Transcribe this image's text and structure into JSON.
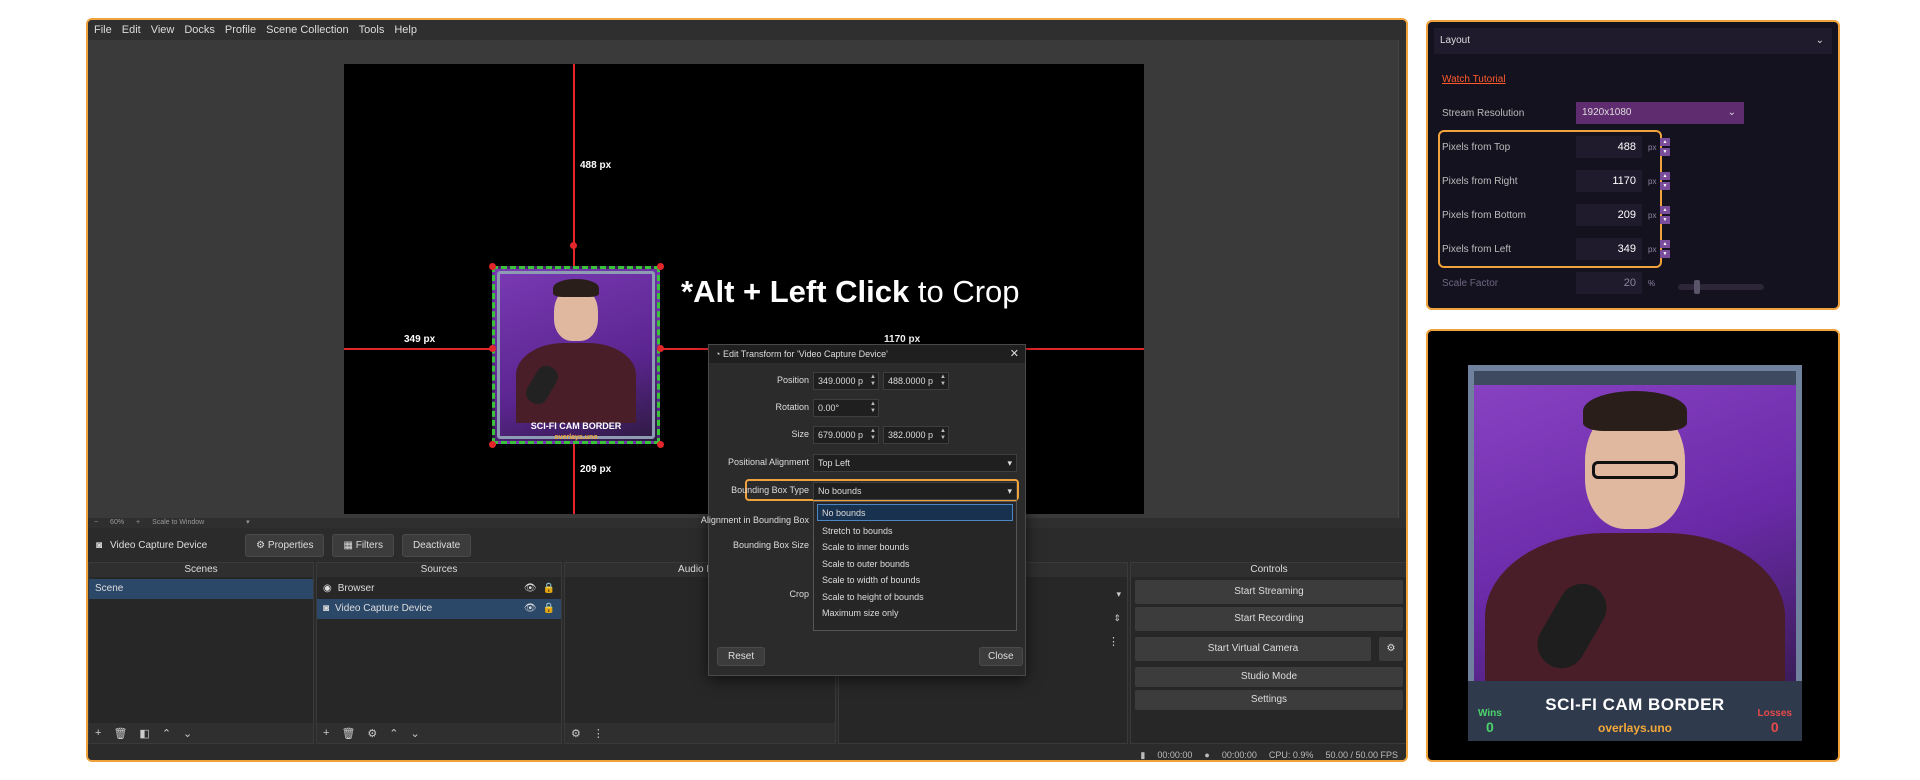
{
  "menu": [
    "File",
    "Edit",
    "View",
    "Docks",
    "Profile",
    "Scene Collection",
    "Tools",
    "Help"
  ],
  "preview": {
    "top_px": "488 px",
    "left_px": "349 px",
    "right_px": "1170 px",
    "bottom_px": "209 px",
    "crop_bold": "*Alt + Left Click",
    "crop_rest": " to Crop",
    "cam_title": "SCI-FI CAM BORDER",
    "cam_url": "overlays.uno"
  },
  "zoom": {
    "value": "60%",
    "mode": "Scale to Window"
  },
  "source_bar": {
    "name": "Video Capture Device",
    "properties": "Properties",
    "filters": "Filters",
    "deactivate": "Deactivate"
  },
  "docks": {
    "scenes": {
      "title": "Scenes",
      "items": [
        "Scene"
      ]
    },
    "sources": {
      "title": "Sources",
      "items": [
        "Browser",
        "Video Capture Device"
      ]
    },
    "audio": {
      "title": "Audio Mix"
    },
    "controls": {
      "title": "Controls",
      "buttons": [
        "Start Streaming",
        "Start Recording",
        "Start Virtual Camera",
        "Studio Mode",
        "Settings"
      ]
    }
  },
  "status": {
    "time1": "00:00:00",
    "time2": "00:00:00",
    "cpu": "CPU: 0.9%",
    "fps": "50.00 / 50.00 FPS"
  },
  "dialog": {
    "title": "Edit Transform for 'Video Capture Device'",
    "position_label": "Position",
    "position_x": "349.0000 p",
    "position_y": "488.0000 p",
    "rotation_label": "Rotation",
    "rotation": "0.00°",
    "size_label": "Size",
    "size_w": "679.0000 p",
    "size_h": "382.0000 p",
    "pos_align_label": "Positional Alignment",
    "pos_align": "Top Left",
    "bbox_type_label": "Bounding Box Type",
    "bbox_type": "No bounds",
    "align_bbox_label": "Alignment in Bounding Box",
    "bbox_size_label": "Bounding Box Size",
    "crop_label": "Crop",
    "reset": "Reset",
    "close": "Close",
    "options": [
      "No bounds",
      "Stretch to bounds",
      "Scale to inner bounds",
      "Scale to outer bounds",
      "Scale to width of bounds",
      "Scale to height of bounds",
      "Maximum size only"
    ]
  },
  "layout_panel": {
    "header": "Layout",
    "tutorial": "Watch Tutorial",
    "resolution_label": "Stream Resolution",
    "resolution": "1920x1080",
    "fields": [
      {
        "label": "Pixels from Top",
        "value": "488",
        "unit": "px"
      },
      {
        "label": "Pixels from Right",
        "value": "1170",
        "unit": "px"
      },
      {
        "label": "Pixels from Bottom",
        "value": "209",
        "unit": "px"
      },
      {
        "label": "Pixels from Left",
        "value": "349",
        "unit": "px"
      }
    ],
    "scale_label": "Scale Factor",
    "scale_value": "20",
    "scale_unit": "%"
  },
  "big_preview": {
    "title": "SCI-FI CAM BORDER",
    "url": "overlays.uno",
    "wins_label": "Wins",
    "wins_value": "0",
    "losses_label": "Losses",
    "losses_value": "0"
  },
  "colors": {
    "accent": "#f0a23c",
    "selection": "#2c4869",
    "red_guide": "#e3262a",
    "link": "#ff5a2a"
  }
}
